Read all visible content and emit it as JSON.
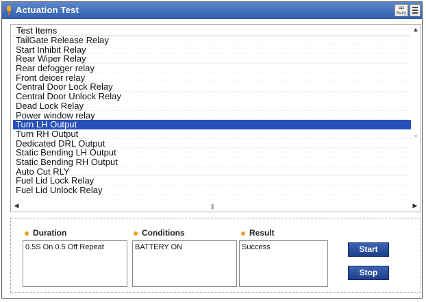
{
  "window": {
    "title": "Actuation Test",
    "retry_label": "Retry",
    "title_icon": "orange-pin-icon",
    "menu_icon": "menu-icon"
  },
  "list": {
    "header": "Test Items",
    "items": [
      "TailGate Release Relay",
      "Start Inhibit Relay",
      "Rear Wiper Relay",
      "Rear defogger relay",
      "Front deicer relay",
      "Central Door Lock Relay",
      "Central Door Unlock Relay",
      "Dead Lock Relay",
      "Power window relay",
      "Turn LH Output",
      "Turn RH Output",
      "Dedicated DRL Output",
      "Static Bending LH Output",
      "Static Bending RH Output",
      "Auto Cut RLY",
      "Fuel Lid Lock Relay",
      "Fuel Lid Unlock Relay"
    ],
    "selected_index": 9,
    "selection_color": "#2950b9"
  },
  "panel": {
    "duration_label": "Duration",
    "duration_value": "0.5S On 0.5 Off Repeat",
    "conditions_label": "Conditions",
    "conditions_value": "BATTERY ON",
    "result_label": "Result",
    "result_value": "Success",
    "start_label": "Start",
    "stop_label": "Stop"
  }
}
